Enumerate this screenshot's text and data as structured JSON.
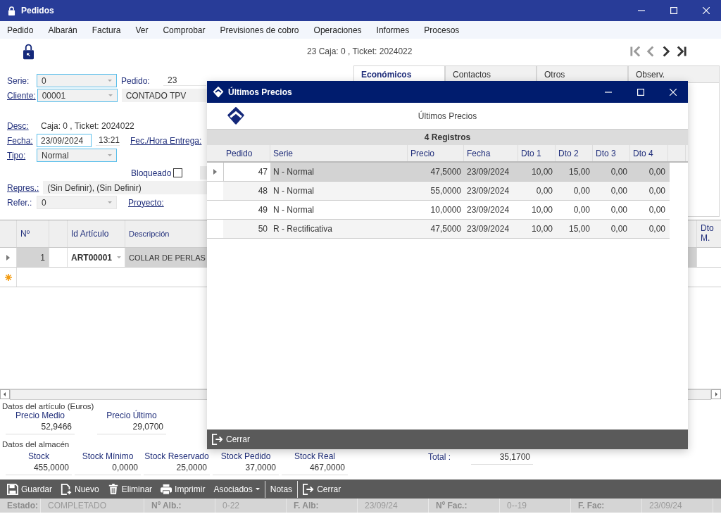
{
  "window": {
    "title": "Pedidos"
  },
  "menu": [
    "Pedido",
    "Albarán",
    "Factura",
    "Ver",
    "Comprobar",
    "Previsiones de cobro",
    "Operaciones",
    "Informes",
    "Procesos"
  ],
  "caption": "23 Caja: 0 , Ticket: 2024022",
  "navigation": [
    {
      "kind": "first",
      "disabled": true
    },
    {
      "kind": "prev",
      "disabled": true
    },
    {
      "kind": "next",
      "disabled": false
    },
    {
      "kind": "last",
      "disabled": false
    }
  ],
  "form": {
    "serie": {
      "label": "Serie:",
      "link": false,
      "value": "0",
      "highlighted": true
    },
    "pedido": {
      "label": "Pedido:",
      "link": false,
      "value": "23"
    },
    "cliente": {
      "label": "Cliente:",
      "link": true,
      "value": "00001",
      "highlighted": true,
      "name": "CONTADO TPV"
    },
    "desc": {
      "label": "Desc:",
      "link": true,
      "value": "Caja: 0 , Ticket: 2024022"
    },
    "fecha": {
      "label": "Fecha:",
      "link": true,
      "value": "23/09/2024",
      "highlighted": true,
      "time": "13:21"
    },
    "entrega": {
      "label": "Fec./Hora Entrega:",
      "link": true
    },
    "tipo": {
      "label": "Tipo:",
      "link": true,
      "value": "Normal",
      "highlighted": true
    },
    "bloqueado": {
      "label": "Bloqueado",
      "checked": false
    },
    "repres": {
      "label": "Repres.:",
      "link": true,
      "value": "(Sin Definir), (Sin Definir)"
    },
    "refer": {
      "label": "Refer.:",
      "link": false,
      "value": "0",
      "highlighted": false
    },
    "proyecto": {
      "label": "Proyecto:",
      "link": true
    }
  },
  "tabs": [
    {
      "label": "Económicos",
      "selected": true
    },
    {
      "label": "Contactos",
      "selected": false
    },
    {
      "label": "Otros",
      "selected": false
    },
    {
      "label": "Observ.",
      "selected": false
    }
  ],
  "lines": {
    "columns": [
      "Nº",
      "Id Artículo",
      "Descripción",
      "Dto M."
    ],
    "rows": [
      {
        "number": "1",
        "article": "ART00001",
        "description": "COLLAR DE PERLAS",
        "selected": true
      }
    ]
  },
  "article_data": {
    "title": "Datos del artículo (Euros)",
    "items": [
      {
        "label": "Precio Medio",
        "value": "52,9466"
      },
      {
        "label": "Precio Último",
        "value": "29,0700"
      }
    ]
  },
  "warehouse": {
    "title": "Datos del almacén",
    "items": [
      {
        "label": "Stock",
        "value": "455,0000"
      },
      {
        "label": "Stock Mínimo",
        "value": "0,0000"
      },
      {
        "label": "Stock Reservado",
        "value": "25,0000"
      },
      {
        "label": "Stock Pedido",
        "value": "37,0000"
      },
      {
        "label": "Stock Real",
        "value": "467,0000"
      }
    ]
  },
  "total": {
    "label": "Total :",
    "value": "35,1700"
  },
  "toolbar": [
    {
      "kind": "save",
      "label": "Guardar"
    },
    {
      "kind": "new",
      "label": "Nuevo"
    },
    {
      "kind": "delete",
      "label": "Eliminar"
    },
    {
      "kind": "print",
      "label": "Imprimir"
    },
    {
      "kind": "dropdown",
      "label": "Asociados"
    },
    {
      "kind": "plain",
      "label": "Notas"
    },
    {
      "kind": "exit",
      "label": "Cerrar"
    }
  ],
  "status_bar": [
    {
      "label": "Estado:",
      "value": "COMPLETADO"
    },
    {
      "label": "Nº Alb.:",
      "value": "0-22"
    },
    {
      "label": "F. Alb:",
      "value": "23/09/24"
    },
    {
      "label": "Nº Fac.:",
      "value": "0--19"
    },
    {
      "label": "F. Fac:",
      "value": "23/09/24"
    }
  ],
  "dialog": {
    "title": "Últimos Precios",
    "heading": "Últimos Precios",
    "count": "4 Registros",
    "columns": [
      "Pedido",
      "Serie",
      "Precio",
      "Fecha",
      "Dto 1",
      "Dto 2",
      "Dto 3",
      "Dto 4"
    ],
    "rows": [
      {
        "cells": [
          "47",
          "N - Normal",
          "47,5000",
          "23/09/2024",
          "10,00",
          "15,00",
          "0,00",
          "0,00"
        ],
        "selected": true
      },
      {
        "cells": [
          "48",
          "N - Normal",
          "55,0000",
          "23/09/2024",
          "0,00",
          "0,00",
          "0,00",
          "0,00"
        ],
        "selected": false
      },
      {
        "cells": [
          "49",
          "N - Normal",
          "10,0000",
          "23/09/2024",
          "10,00",
          "0,00",
          "0,00",
          "0,00"
        ],
        "selected": false
      },
      {
        "cells": [
          "50",
          "R - Rectificativa",
          "47,5000",
          "23/09/2024",
          "10,00",
          "15,00",
          "0,00",
          "0,00"
        ],
        "selected": false
      }
    ],
    "close": "Cerrar"
  }
}
